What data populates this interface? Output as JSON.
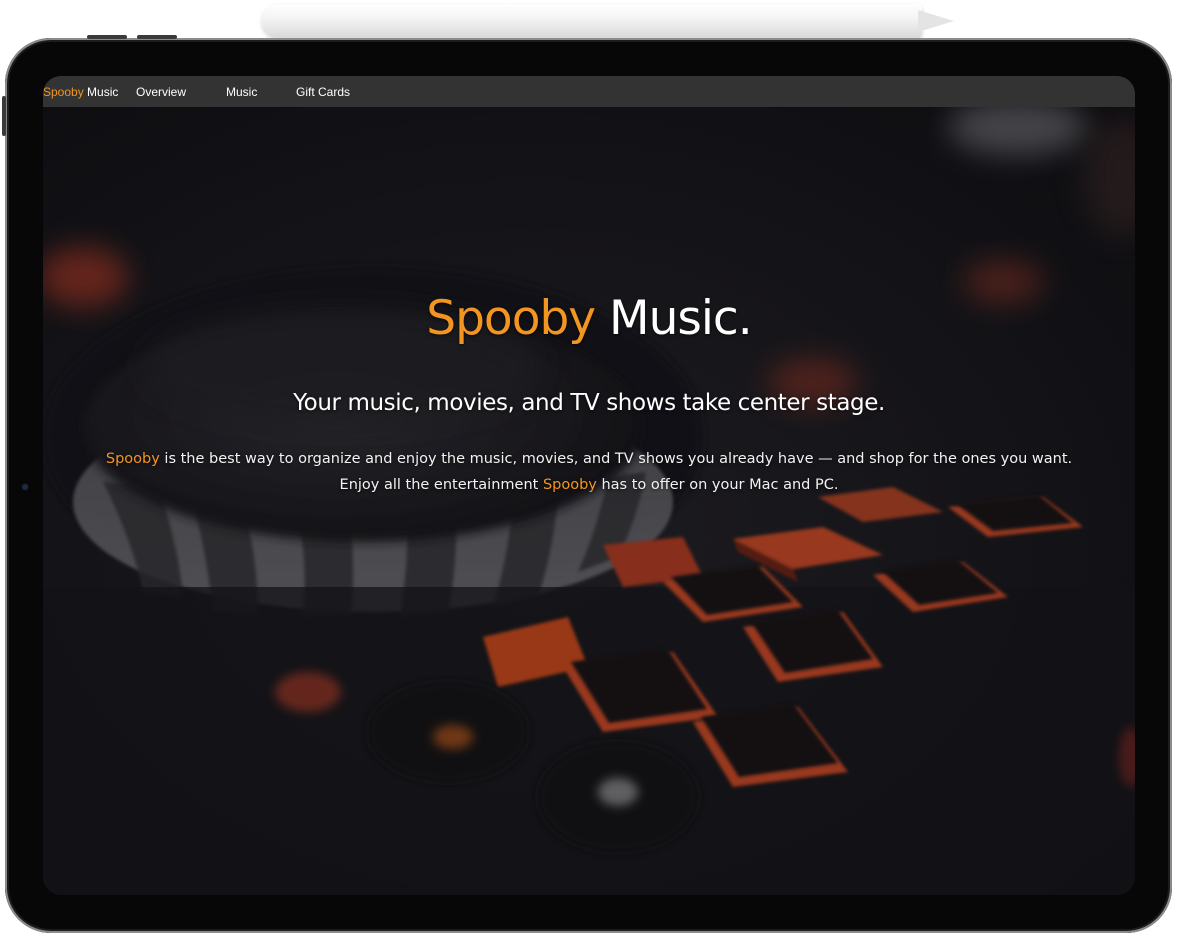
{
  "colors": {
    "accent": "#f39521",
    "nav_background": "#333333",
    "text": "#ffffff",
    "device_frame": "#070707"
  },
  "nav": {
    "brand_accent": "Spooby",
    "brand_rest": "Music",
    "items": [
      {
        "label": "Overview"
      },
      {
        "label": "Music"
      },
      {
        "label": "Gift Cards"
      }
    ]
  },
  "hero": {
    "title_accent": "Spooby",
    "title_rest": "Music.",
    "subtitle": "Your music, movies, and TV shows take center stage.",
    "body": {
      "line1_accent": "Spooby",
      "line1_rest": "is the best way to organize and enjoy the music, movies, and TV shows you already have — and shop for the ones you want.",
      "line2_start": "Enjoy all the entertainment",
      "line2_accent": "Spooby",
      "line2_end": "has to offer on your Mac and PC."
    },
    "background_image": "dj-controller-photo"
  },
  "device": {
    "accessory": "stylus-pencil",
    "camera": "front-camera-icon"
  }
}
